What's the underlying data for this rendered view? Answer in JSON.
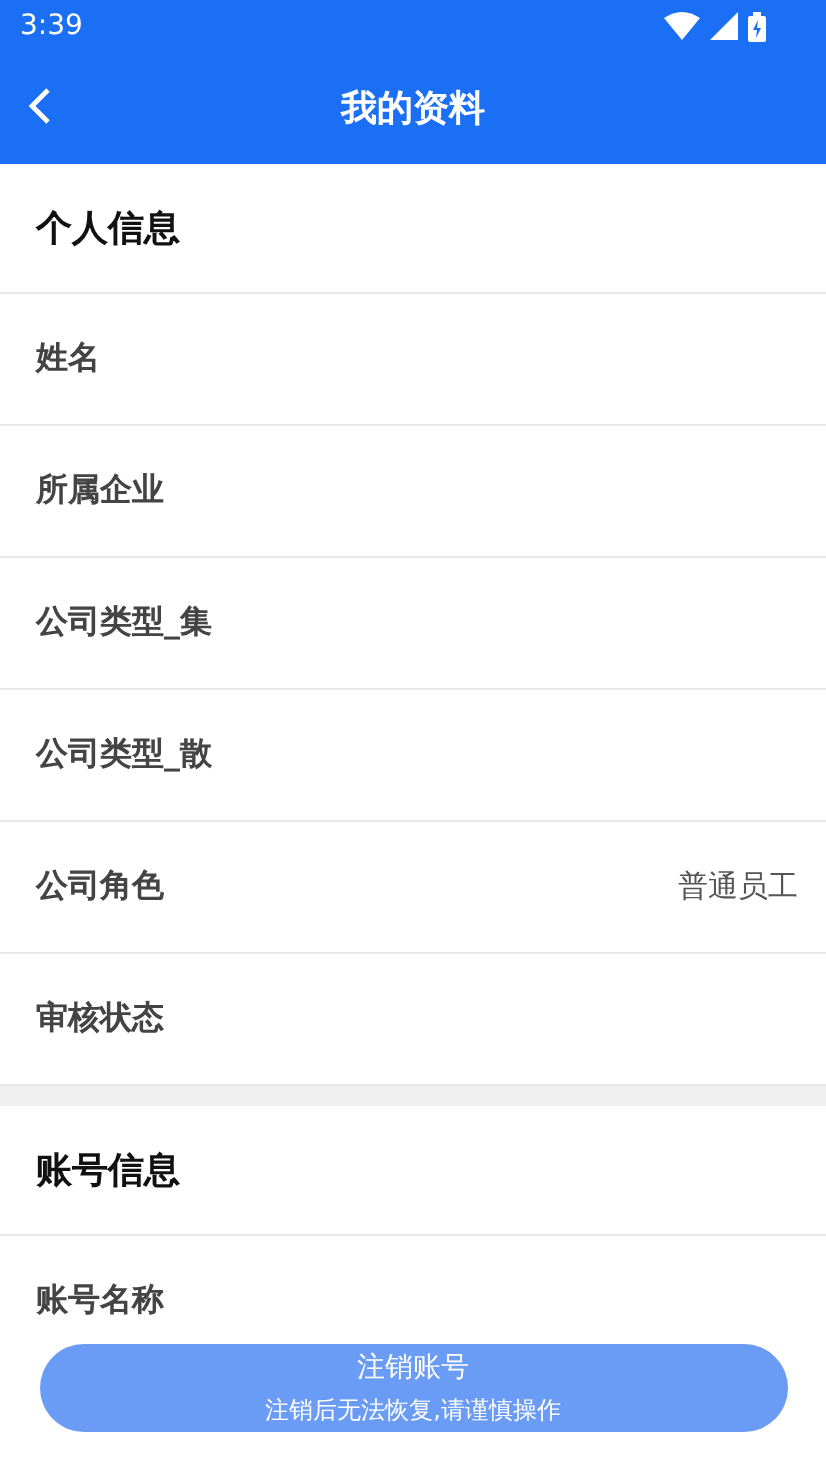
{
  "status_bar": {
    "time": "3:39"
  },
  "header": {
    "title": "我的资料"
  },
  "sections": [
    {
      "title": "个人信息",
      "rows": [
        {
          "label": "姓名"
        },
        {
          "label": "所属企业"
        },
        {
          "label": "公司类型_集"
        },
        {
          "label": "公司类型_散"
        },
        {
          "label": "公司角色",
          "value": "普通员工"
        },
        {
          "label": "审核状态"
        }
      ]
    },
    {
      "title": "账号信息",
      "rows": [
        {
          "label": "账号名称"
        }
      ]
    }
  ],
  "footer_button": {
    "label": "注销账号",
    "note": "注销后无法恢复,请谨慎操作"
  }
}
